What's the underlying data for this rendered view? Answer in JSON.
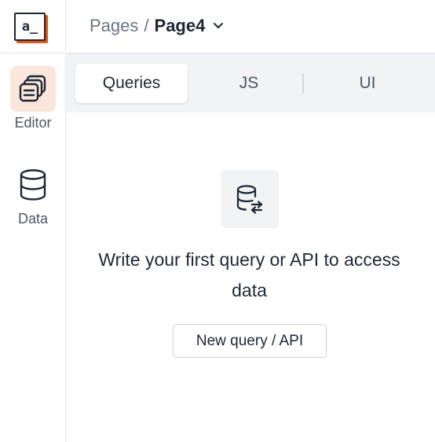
{
  "app": {
    "logo_text": "a_",
    "accent_color": "#e15615"
  },
  "sidebar": {
    "items": [
      {
        "label": "Editor",
        "icon": "editor-icon",
        "active": true
      },
      {
        "label": "Data",
        "icon": "database-icon",
        "active": false
      }
    ]
  },
  "header": {
    "breadcrumb_root": "Pages",
    "breadcrumb_separator": "/",
    "current_page": "Page4"
  },
  "tabs": [
    {
      "label": "Queries",
      "active": true
    },
    {
      "label": "JS",
      "active": false
    },
    {
      "label": "UI",
      "active": false
    }
  ],
  "empty_state": {
    "icon": "database-refresh-icon",
    "message": "Write your first query or API to access data",
    "button_label": "New query / API"
  }
}
